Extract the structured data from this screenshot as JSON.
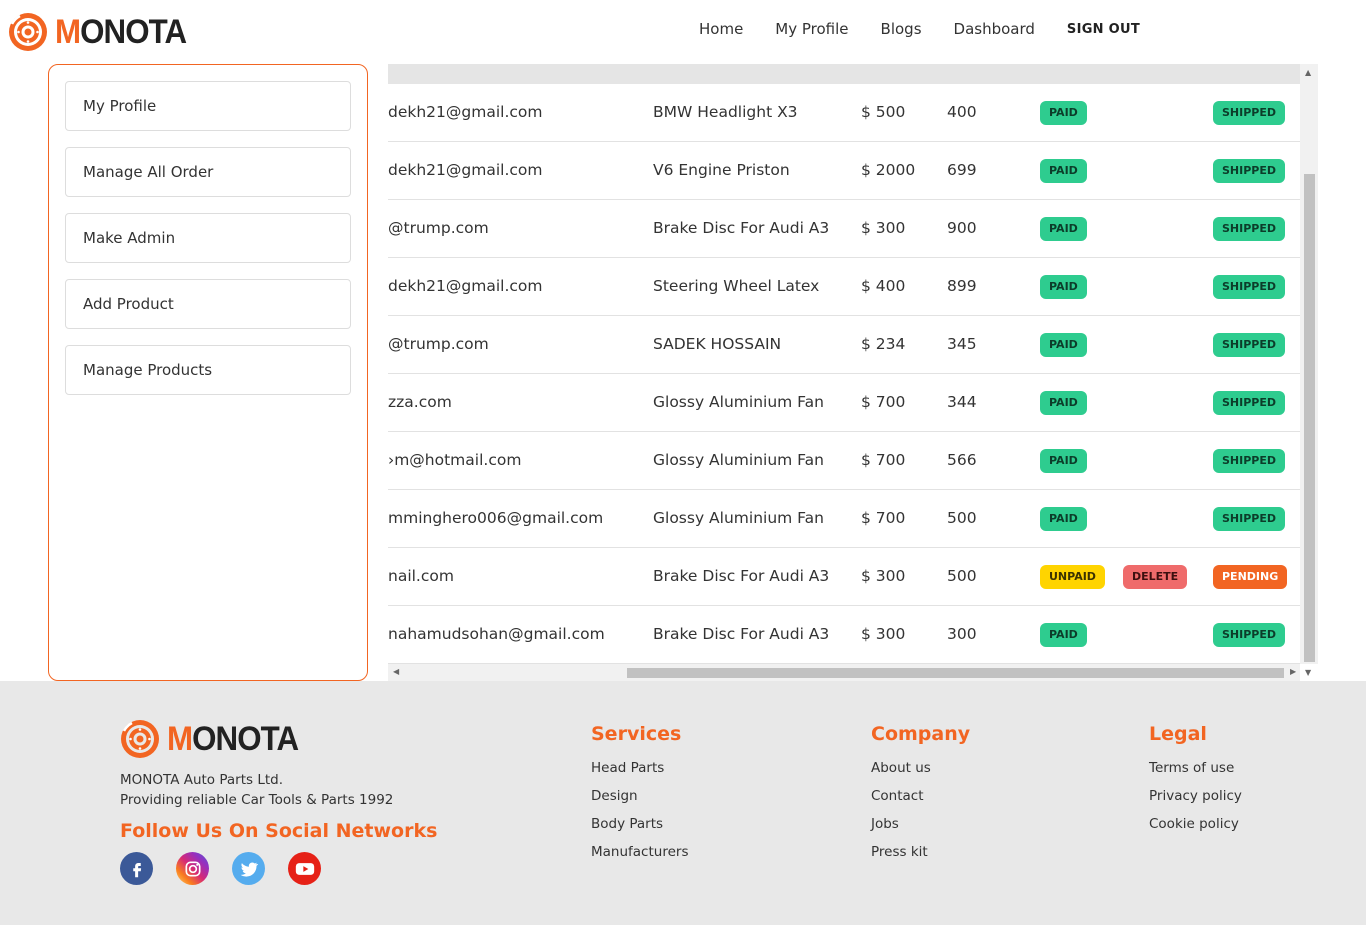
{
  "brand": {
    "first_letter": "M",
    "rest": "ONOTA",
    "accent": "#f26522"
  },
  "nav": {
    "home": "Home",
    "my_profile": "My Profile",
    "blogs": "Blogs",
    "dashboard": "Dashboard",
    "sign_out": "SIGN OUT"
  },
  "sidebar": {
    "items": [
      {
        "label": "My Profile"
      },
      {
        "label": "Manage All Order"
      },
      {
        "label": "Make Admin"
      },
      {
        "label": "Add Product"
      },
      {
        "label": "Manage Products"
      }
    ]
  },
  "orders": [
    {
      "email": "dekh21@gmail.com",
      "product": "BMW Headlight X3",
      "price": "$ 500",
      "qty": "400",
      "payment": "PAID",
      "action": "",
      "status": "SHIPPED"
    },
    {
      "email": "dekh21@gmail.com",
      "product": "V6 Engine Priston",
      "price": "$ 2000",
      "qty": "699",
      "payment": "PAID",
      "action": "",
      "status": "SHIPPED"
    },
    {
      "email": "@trump.com",
      "product": "Brake Disc For Audi A3",
      "price": "$ 300",
      "qty": "900",
      "payment": "PAID",
      "action": "",
      "status": "SHIPPED"
    },
    {
      "email": "dekh21@gmail.com",
      "product": "Steering Wheel Latex",
      "price": "$ 400",
      "qty": "899",
      "payment": "PAID",
      "action": "",
      "status": "SHIPPED"
    },
    {
      "email": "@trump.com",
      "product": "SADEK HOSSAIN",
      "price": "$ 234",
      "qty": "345",
      "payment": "PAID",
      "action": "",
      "status": "SHIPPED"
    },
    {
      "email": "zza.com",
      "product": "Glossy Aluminium Fan",
      "price": "$ 700",
      "qty": "344",
      "payment": "PAID",
      "action": "",
      "status": "SHIPPED"
    },
    {
      "email": "›m@hotmail.com",
      "product": "Glossy Aluminium Fan",
      "price": "$ 700",
      "qty": "566",
      "payment": "PAID",
      "action": "",
      "status": "SHIPPED"
    },
    {
      "email": "mminghero006@gmail.com",
      "product": "Glossy Aluminium Fan",
      "price": "$ 700",
      "qty": "500",
      "payment": "PAID",
      "action": "",
      "status": "SHIPPED"
    },
    {
      "email": "nail.com",
      "product": "Brake Disc For Audi A3",
      "price": "$ 300",
      "qty": "500",
      "payment": "UNPAID",
      "action": "DELETE",
      "status": "PENDING"
    },
    {
      "email": "nahamudsohan@gmail.com",
      "product": "Brake Disc For Audi A3",
      "price": "$ 300",
      "qty": "300",
      "payment": "PAID",
      "action": "",
      "status": "SHIPPED"
    }
  ],
  "footer": {
    "company_name": "MONOTA Auto Parts Ltd.",
    "tagline": "Providing reliable Car Tools & Parts 1992",
    "follow_heading": "Follow Us On Social Networks",
    "socials": [
      "facebook-icon",
      "instagram-icon",
      "twitter-icon",
      "youtube-icon"
    ],
    "services": {
      "heading": "Services",
      "links": [
        "Head Parts",
        "Design",
        "Body Parts",
        "Manufacturers"
      ]
    },
    "company": {
      "heading": "Company",
      "links": [
        "About us",
        "Contact",
        "Jobs",
        "Press kit"
      ]
    },
    "legal": {
      "heading": "Legal",
      "links": [
        "Terms of use",
        "Privacy policy",
        "Cookie policy"
      ]
    }
  }
}
